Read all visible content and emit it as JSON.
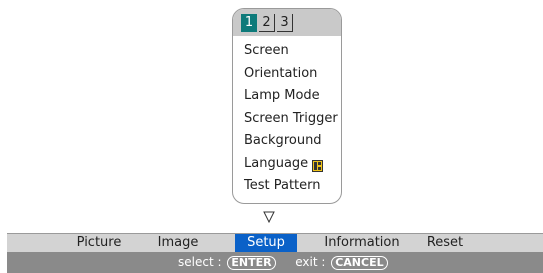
{
  "submenu": {
    "tabs": [
      "1",
      "2",
      "3"
    ],
    "active_tab": "1",
    "items": [
      "Screen",
      "Orientation",
      "Lamp Mode",
      "Screen Trigger",
      "Background",
      "Language",
      "Test Pattern"
    ],
    "language_icon": "language-flag-icon",
    "scroll_indicator": "down-triangle-icon"
  },
  "main_menu": {
    "items": [
      "Picture",
      "Image",
      "Setup",
      "Information",
      "Reset"
    ],
    "active_item": "Setup"
  },
  "hints": {
    "select_label": "select :",
    "select_key": "ENTER",
    "exit_label": "exit :",
    "exit_key": "CANCEL"
  },
  "colors": {
    "submenu_active_tab": "#0d7a7a",
    "main_active_item": "#0a61c8",
    "main_bar_bg": "#d3d3d3",
    "hint_bar_bg": "#8a8a8a"
  }
}
